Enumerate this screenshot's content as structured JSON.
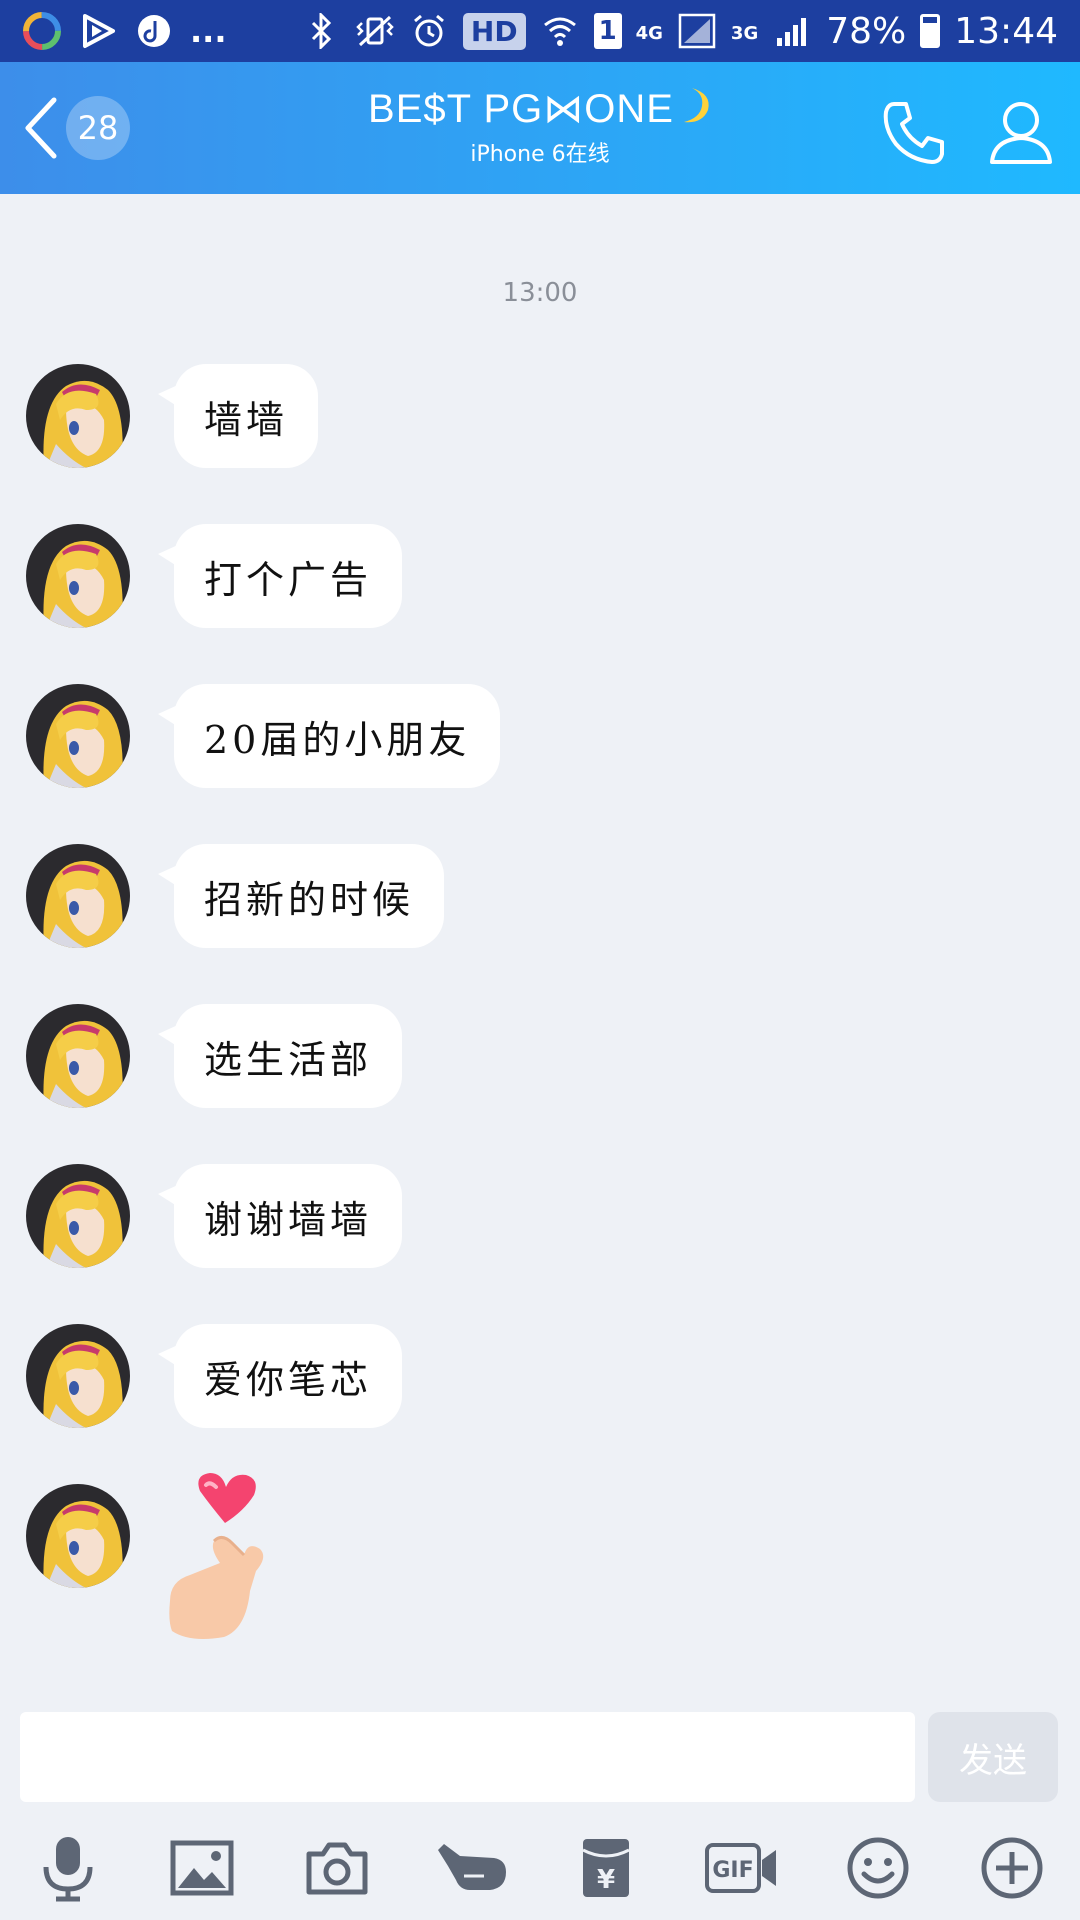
{
  "status_bar": {
    "dots": "...",
    "hd": "HD",
    "sim": "1",
    "net_4g": "4G",
    "net_3g": "3G",
    "battery": "78%",
    "time": "13:44"
  },
  "header": {
    "unread_count": "28",
    "title": "BE$T PG⋈ONE",
    "subtitle": "iPhone 6在线"
  },
  "chat": {
    "timestamp": "13:00",
    "messages": [
      {
        "text": "墙墙"
      },
      {
        "text": "打个广告"
      },
      {
        "text": "20届的小朋友"
      },
      {
        "text": "招新的时候"
      },
      {
        "text": "选生活部"
      },
      {
        "text": "谢谢墙墙"
      },
      {
        "text": "爱你笔芯"
      },
      {
        "sticker": "finger-heart-sticker"
      }
    ]
  },
  "input": {
    "value": "",
    "placeholder": "",
    "send_label": "发送"
  },
  "toolbar": {
    "icons": [
      "microphone-icon",
      "image-icon",
      "camera-icon",
      "poke-icon",
      "red-packet-icon",
      "gif-icon",
      "emoji-icon",
      "plus-icon"
    ]
  },
  "colors": {
    "header_start": "#3d8eea",
    "header_end": "#1fb9ff",
    "status_bar": "#1d3fa0",
    "background": "#eef1f6",
    "toolbar_icon": "#5d6675"
  }
}
